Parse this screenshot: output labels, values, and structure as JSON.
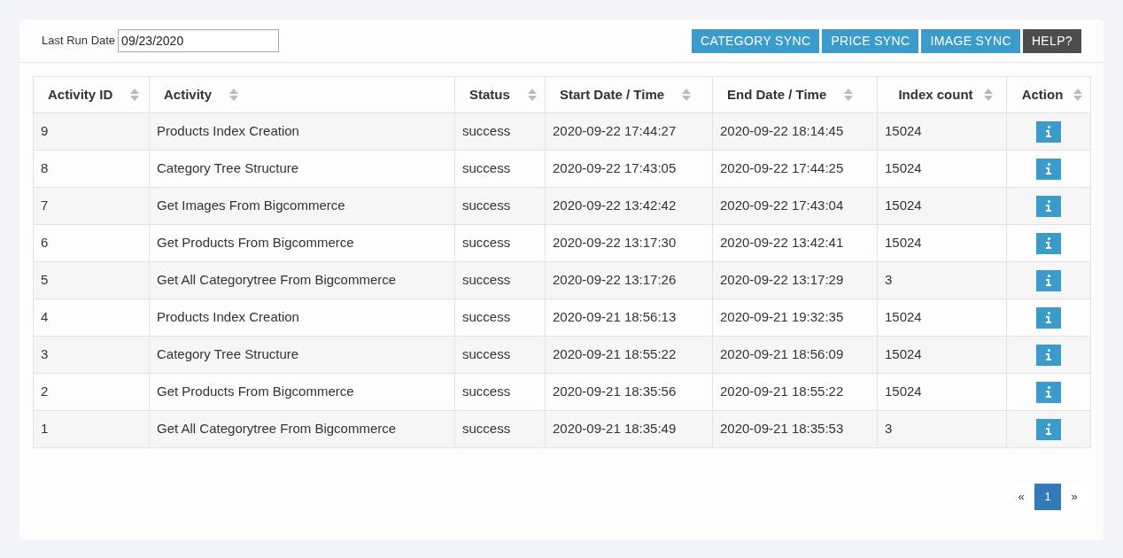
{
  "filter": {
    "label": "Last Run Date",
    "value": "09/23/2020"
  },
  "buttons": [
    {
      "label": "CATEGORY SYNC",
      "kind": "primary"
    },
    {
      "label": "PRICE SYNC",
      "kind": "primary"
    },
    {
      "label": "IMAGE SYNC",
      "kind": "primary"
    },
    {
      "label": "HELP?",
      "kind": "dark"
    }
  ],
  "table": {
    "columns": [
      "Activity ID",
      "Activity",
      "Status",
      "Start Date / Time",
      "End Date / Time",
      "Index count",
      "Action"
    ],
    "rows": [
      [
        "9",
        "Products Index Creation",
        "success",
        "2020-09-22 17:44:27",
        "2020-09-22 18:14:45",
        "15024"
      ],
      [
        "8",
        "Category Tree Structure",
        "success",
        "2020-09-22 17:43:05",
        "2020-09-22 17:44:25",
        "15024"
      ],
      [
        "7",
        "Get Images From Bigcommerce",
        "success",
        "2020-09-22 13:42:42",
        "2020-09-22 17:43:04",
        "15024"
      ],
      [
        "6",
        "Get Products From Bigcommerce",
        "success",
        "2020-09-22 13:17:30",
        "2020-09-22 13:42:41",
        "15024"
      ],
      [
        "5",
        "Get All Categorytree From Bigcommerce",
        "success",
        "2020-09-22 13:17:26",
        "2020-09-22 13:17:29",
        "3"
      ],
      [
        "4",
        "Products Index Creation",
        "success",
        "2020-09-21 18:56:13",
        "2020-09-21 19:32:35",
        "15024"
      ],
      [
        "3",
        "Category Tree Structure",
        "success",
        "2020-09-21 18:55:22",
        "2020-09-21 18:56:09",
        "15024"
      ],
      [
        "2",
        "Get Products From Bigcommerce",
        "success",
        "2020-09-21 18:35:56",
        "2020-09-21 18:55:22",
        "15024"
      ],
      [
        "1",
        "Get All Categorytree From Bigcommerce",
        "success",
        "2020-09-21 18:35:49",
        "2020-09-21 18:35:53",
        "3"
      ]
    ]
  },
  "pagination": {
    "prev": "«",
    "pages": [
      {
        "label": "1",
        "selected": true
      }
    ],
    "next": "»"
  }
}
